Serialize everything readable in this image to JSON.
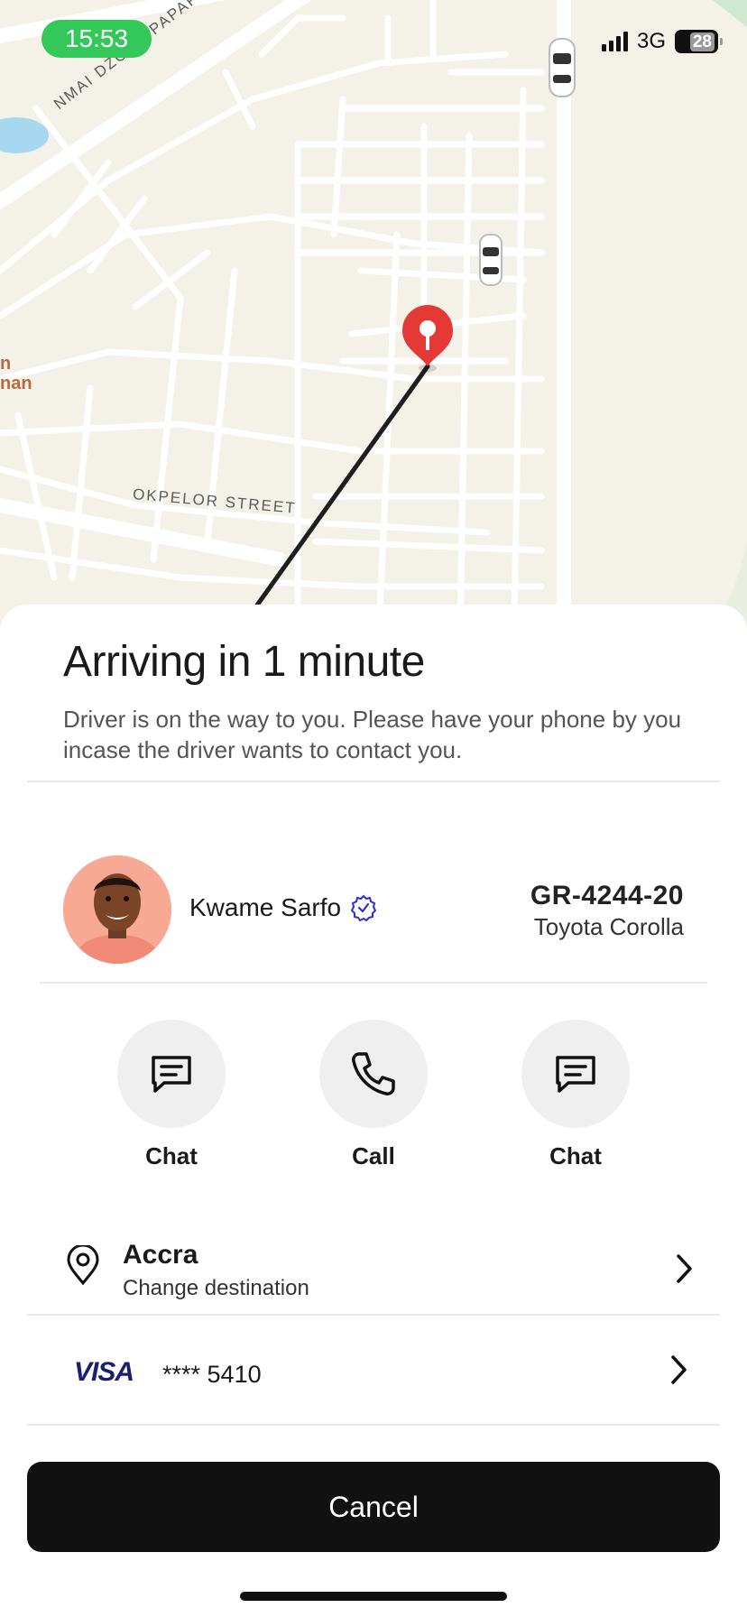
{
  "status_bar": {
    "time": "15:53",
    "network": "3G",
    "battery": "28"
  },
  "map": {
    "road_labels": [
      "NMAI DZORN PAPAFIO HILLS RO",
      "OKPELOR STREET"
    ],
    "place_label": [
      "n",
      "nan"
    ],
    "colors": {
      "land": "#f4f1e8",
      "road": "#ffffff",
      "route": "#1e1e1e",
      "pin": "#e53935",
      "water": "#a8d8f0"
    }
  },
  "trip": {
    "title": "Arriving in 1 minute",
    "description": "Driver is on the way to you. Please have your phone by you incase the driver wants to contact you."
  },
  "driver": {
    "name": "Kwame Sarfo",
    "verified_icon": "verified-badge-icon",
    "plate": "GR-4244-20",
    "car": "Toyota Corolla"
  },
  "actions": [
    {
      "label": "Chat",
      "icon": "message-icon"
    },
    {
      "label": "Call",
      "icon": "phone-icon"
    },
    {
      "label": "Chat",
      "icon": "message-icon"
    }
  ],
  "destination": {
    "title": "Accra",
    "subtitle": "Change destination"
  },
  "payment": {
    "brand": "VISA",
    "card": "**** 5410"
  },
  "cancel_label": "Cancel"
}
